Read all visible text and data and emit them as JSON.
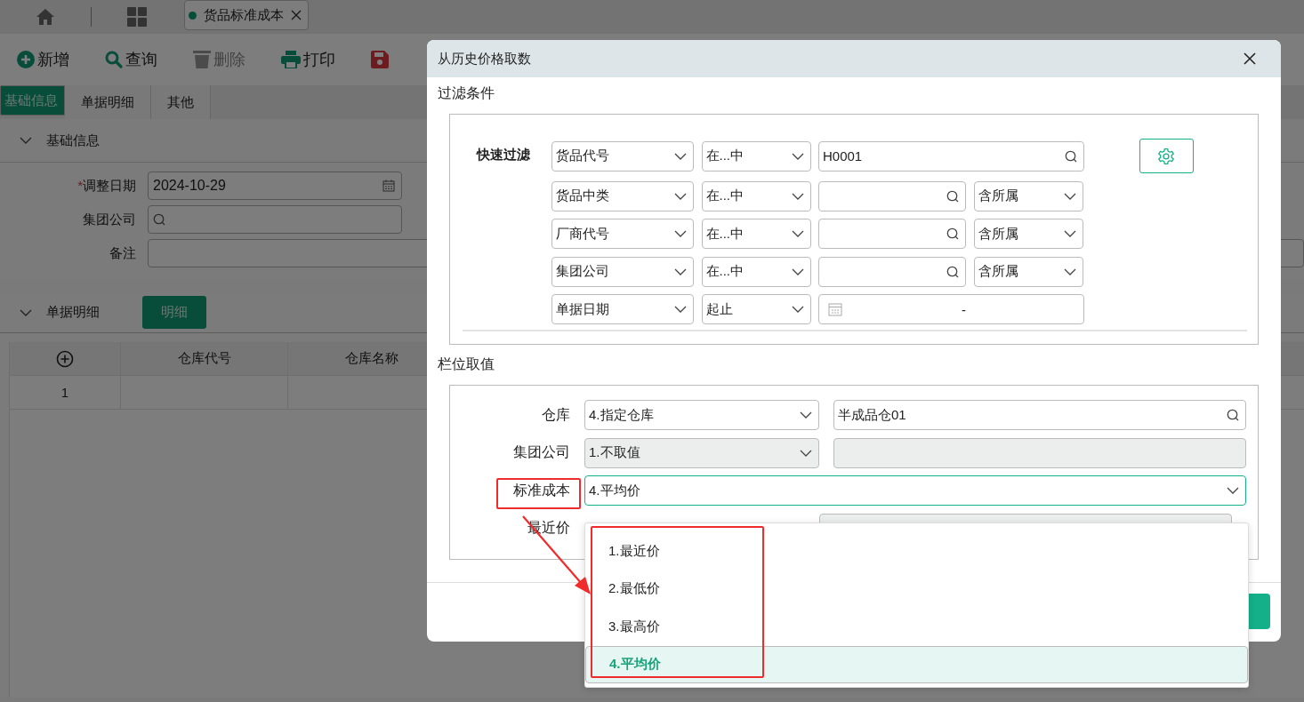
{
  "tab_bar": {
    "tabs": [
      {
        "kind": "home",
        "selected": false
      },
      {
        "kind": "apps",
        "selected": false
      },
      {
        "kind": "page",
        "label": "货品标准成本",
        "selected": true
      }
    ]
  },
  "toolbar": [
    {
      "kind": "add",
      "label": "新增",
      "disabled": false
    },
    {
      "kind": "search",
      "label": "查询",
      "disabled": false
    },
    {
      "kind": "delete",
      "label": "删除",
      "disabled": true
    },
    {
      "kind": "print",
      "label": "打印",
      "disabled": false
    },
    {
      "kind": "save",
      "disabled": false
    }
  ],
  "form_tabs": [
    {
      "label": "基础信息",
      "selected": true
    },
    {
      "label": "单据明细",
      "selected": false
    },
    {
      "label": "其他",
      "selected": false
    }
  ],
  "basic_section": {
    "title": "基础信息",
    "expanded": true,
    "required_mark": "*",
    "fields": [
      {
        "label": "调整日期",
        "required": true,
        "kind": "date",
        "value": "2024-10-29"
      },
      {
        "label": "集团公司",
        "required": false,
        "kind": "lookup"
      },
      {
        "label": "备注",
        "required": false,
        "kind": "text"
      }
    ]
  },
  "detail_section": {
    "title": "单据明细",
    "expanded": true,
    "button": "明细",
    "table": {
      "columns": [
        "仓库代号",
        "仓库名称"
      ],
      "rows": [
        {
          "row_number": "1"
        }
      ]
    }
  },
  "dialog": {
    "title": "从历史价格取数",
    "filter": {
      "title": "过滤条件",
      "label": "快速过滤",
      "rows": [
        {
          "kind": "lookup",
          "field": "货品代号",
          "operator": "在...中",
          "value": "H0001"
        },
        {
          "kind": "lookup",
          "field": "货品中类",
          "operator": "在...中",
          "scope": "含所属"
        },
        {
          "kind": "lookup",
          "field": "厂商代号",
          "operator": "在...中",
          "scope": "含所属"
        },
        {
          "kind": "lookup",
          "field": "集团公司",
          "operator": "在...中",
          "scope": "含所属"
        },
        {
          "kind": "date_range",
          "field": "单据日期",
          "operator": "起止",
          "separator": "-"
        }
      ]
    },
    "values": {
      "title": "栏位取值",
      "rows": [
        {
          "kind": "pair",
          "label": "仓库",
          "option": "4.指定仓库",
          "value": "半成品仓01",
          "disabled": false
        },
        {
          "kind": "pair",
          "label": "集团公司",
          "option": "1.不取值",
          "disabled": true
        },
        {
          "kind": "single",
          "label": "标准成本",
          "option": "4.平均价",
          "focused": true
        },
        {
          "kind": "pair",
          "label": "最近价",
          "disabled": true
        }
      ]
    },
    "dropdown": {
      "options": [
        {
          "label": "1.最近价",
          "selected": false
        },
        {
          "label": "2.最低价",
          "selected": false
        },
        {
          "label": "3.最高价",
          "selected": false
        },
        {
          "label": "4.平均价",
          "selected": true
        }
      ]
    }
  }
}
